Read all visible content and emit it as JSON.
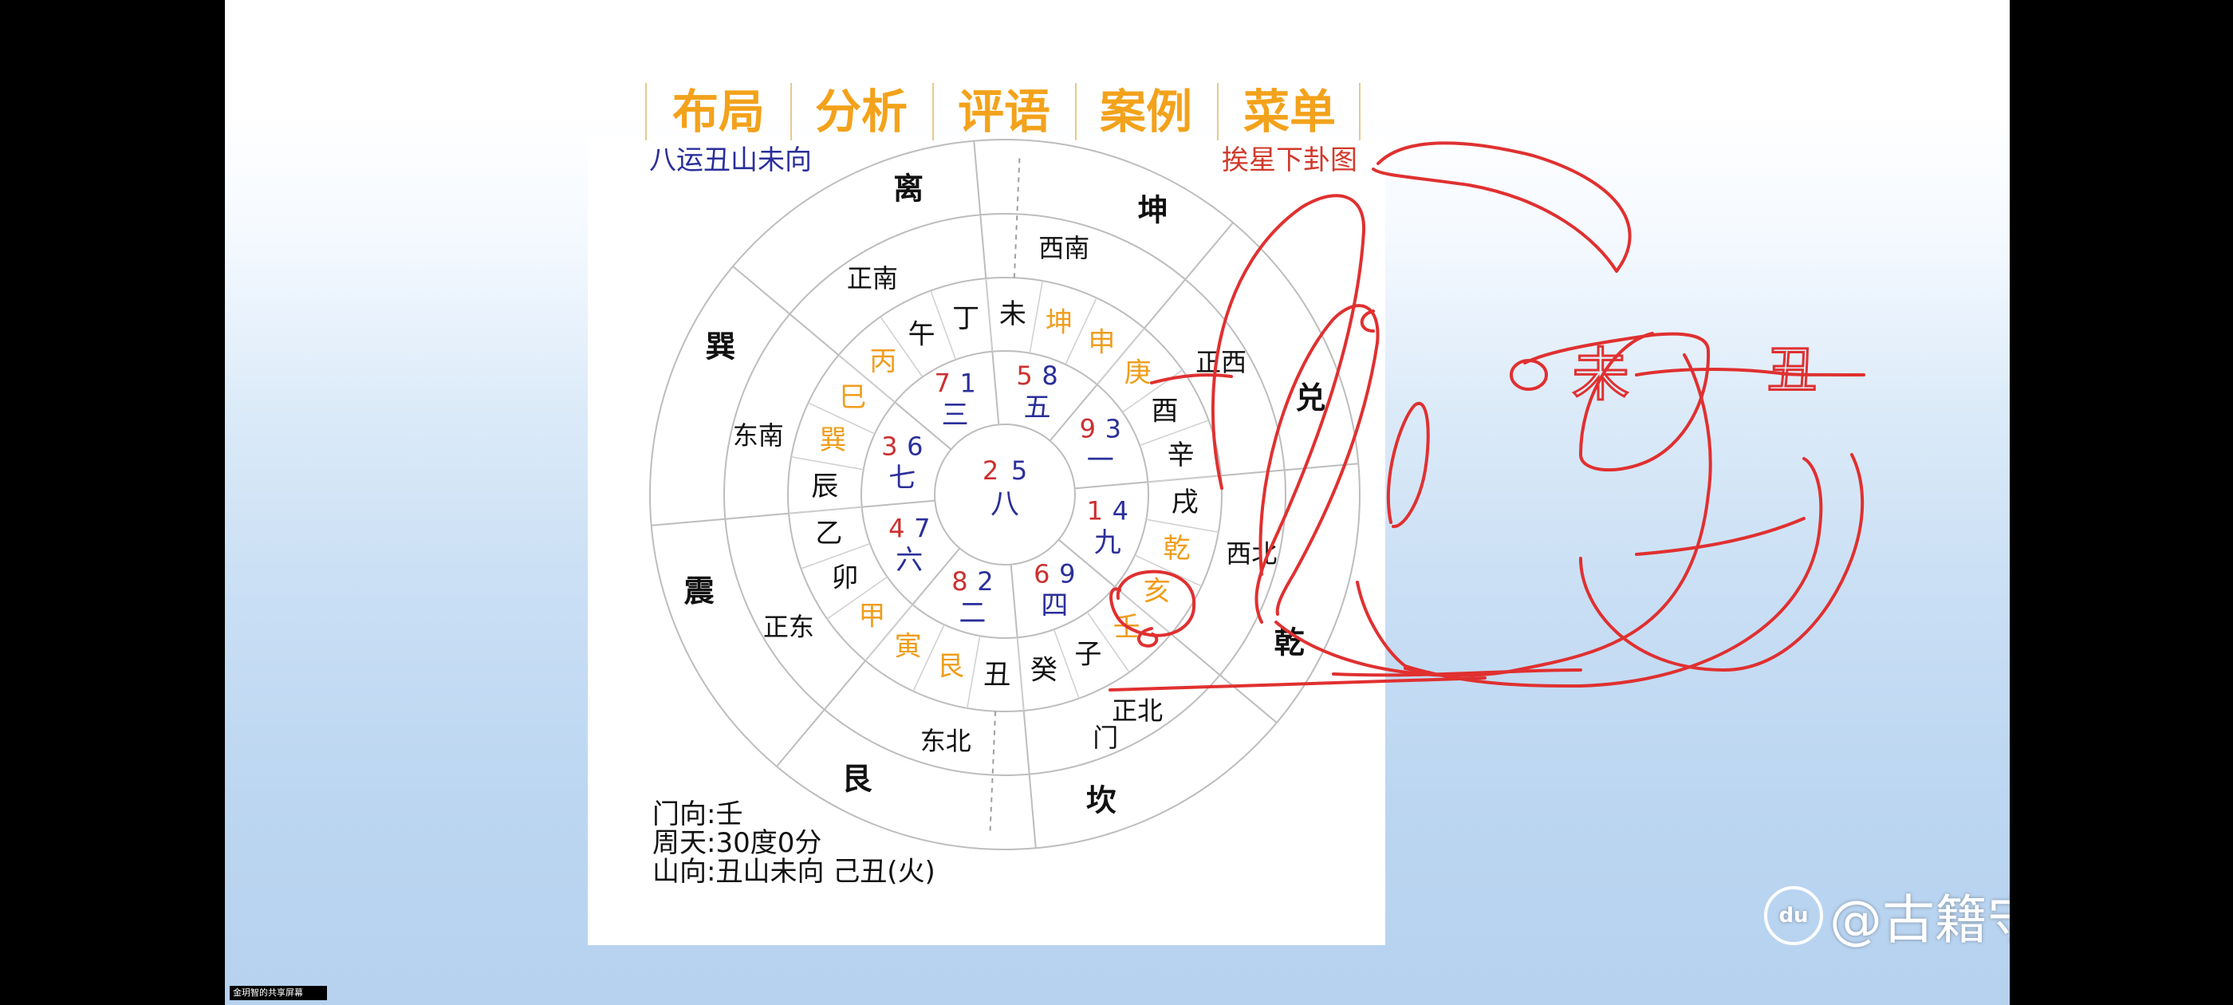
{
  "tabs": [
    "布局",
    "分析",
    "评语",
    "案例",
    "菜单"
  ],
  "chart_title_left": "八运丑山未向",
  "chart_title_right": "挨星下卦图",
  "center": {
    "mountain": "2",
    "facing": "5",
    "period": "八"
  },
  "palaces": [
    {
      "id": "sw",
      "mountain": "5",
      "facing": "8",
      "period": "五"
    },
    {
      "id": "west",
      "mountain": "9",
      "facing": "3",
      "period": "一"
    },
    {
      "id": "nw",
      "mountain": "1",
      "facing": "4",
      "period": "九"
    },
    {
      "id": "north",
      "mountain": "6",
      "facing": "9",
      "period": "四"
    },
    {
      "id": "ne",
      "mountain": "8",
      "facing": "2",
      "period": "二"
    },
    {
      "id": "east",
      "mountain": "4",
      "facing": "7",
      "period": "六"
    },
    {
      "id": "se",
      "mountain": "3",
      "facing": "6",
      "period": "七"
    },
    {
      "id": "south",
      "mountain": "7",
      "facing": "1",
      "period": "三"
    }
  ],
  "mountains": [
    {
      "char": "未",
      "tone": "black"
    },
    {
      "char": "坤",
      "tone": "orange"
    },
    {
      "char": "申",
      "tone": "orange"
    },
    {
      "char": "庚",
      "tone": "orange"
    },
    {
      "char": "酉",
      "tone": "black"
    },
    {
      "char": "辛",
      "tone": "black"
    },
    {
      "char": "戌",
      "tone": "black"
    },
    {
      "char": "乾",
      "tone": "orange"
    },
    {
      "char": "亥",
      "tone": "orange"
    },
    {
      "char": "壬",
      "tone": "orange"
    },
    {
      "char": "子",
      "tone": "black"
    },
    {
      "char": "癸",
      "tone": "black"
    },
    {
      "char": "丑",
      "tone": "black"
    },
    {
      "char": "艮",
      "tone": "orange"
    },
    {
      "char": "寅",
      "tone": "orange"
    },
    {
      "char": "甲",
      "tone": "orange"
    },
    {
      "char": "卯",
      "tone": "black"
    },
    {
      "char": "乙",
      "tone": "black"
    },
    {
      "char": "辰",
      "tone": "black"
    },
    {
      "char": "巽",
      "tone": "orange"
    },
    {
      "char": "巳",
      "tone": "orange"
    },
    {
      "char": "丙",
      "tone": "orange"
    },
    {
      "char": "午",
      "tone": "black"
    },
    {
      "char": "丁",
      "tone": "black"
    }
  ],
  "directions": [
    "西南",
    "正西",
    "西北",
    "正北",
    "东北",
    "正东",
    "东南",
    "正南"
  ],
  "trigrams": [
    "坤",
    "兑",
    "乾",
    "坎",
    "艮",
    "震",
    "巽",
    "离"
  ],
  "door_label": "门",
  "info": [
    "门向:壬",
    "周天:30度0分",
    "山向:丑山未向 己丑(火)"
  ],
  "annotations": [
    "未",
    "丑"
  ],
  "share_label": "金玥智的共享屏幕",
  "watermark": {
    "logo": "du",
    "text": "@古籍守护人"
  },
  "colors": {
    "tab": "#f3a21b",
    "title_left": "#2b2f9a",
    "title_right": "#d0392b",
    "mountain_star": "#cc3030",
    "facing_star": "#2b2f9a",
    "orange_char": "#ef9d1c",
    "pen_ink": "#e03030"
  }
}
